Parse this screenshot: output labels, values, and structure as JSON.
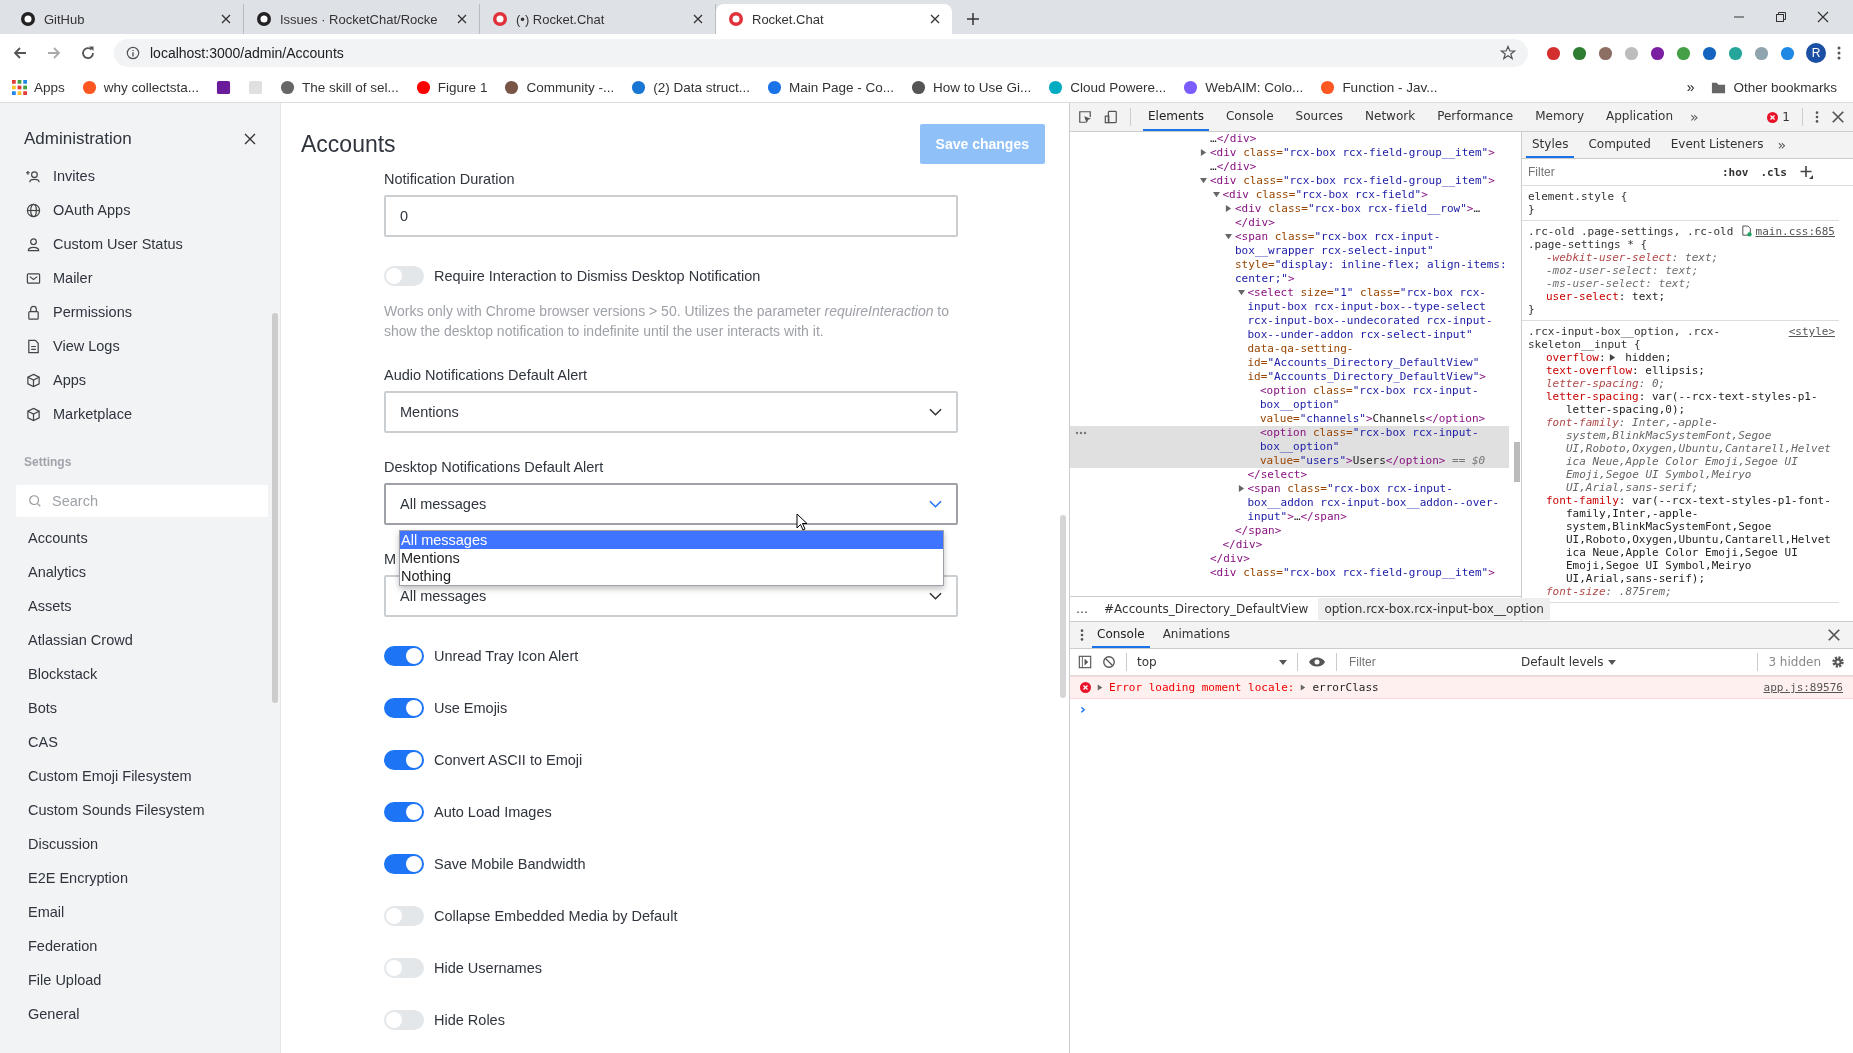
{
  "browser": {
    "tabs": [
      {
        "title": "GitHub",
        "selected": false
      },
      {
        "title": "Issues · RocketChat/Rocke",
        "selected": false
      },
      {
        "title": "(•) Rocket.Chat",
        "selected": false
      },
      {
        "title": "Rocket.Chat",
        "selected": true
      }
    ],
    "url": "localhost:3000/admin/Accounts",
    "profile_initial": "R",
    "bookmarks": [
      {
        "kind": "apps",
        "label": "Apps"
      },
      {
        "kind": "link",
        "label": "why collectsta..."
      },
      {
        "kind": "icon"
      },
      {
        "kind": "icon"
      },
      {
        "kind": "link",
        "label": "The skill of sel..."
      },
      {
        "kind": "link",
        "label": "Figure 1"
      },
      {
        "kind": "link",
        "label": "Community -..."
      },
      {
        "kind": "link",
        "label": "(2) Data struct..."
      },
      {
        "kind": "link",
        "label": "Main Page - Co..."
      },
      {
        "kind": "link",
        "label": "How to Use Gi..."
      },
      {
        "kind": "link",
        "label": "Cloud Powere..."
      },
      {
        "kind": "link",
        "label": "WebAIM: Colo..."
      },
      {
        "kind": "link",
        "label": "Function - Jav..."
      }
    ],
    "bookmarks_more": "»",
    "other_bookmarks": "Other bookmarks"
  },
  "sidebar": {
    "title": "Administration",
    "items": [
      "Invites",
      "OAuth Apps",
      "Custom User Status",
      "Mailer",
      "Permissions",
      "View Logs",
      "Apps",
      "Marketplace"
    ],
    "settings_heading": "Settings",
    "search": {
      "placeholder": "Search"
    },
    "settings": [
      "Accounts",
      "Analytics",
      "Assets",
      "Atlassian Crowd",
      "Blockstack",
      "Bots",
      "CAS",
      "Custom Emoji Filesystem",
      "Custom Sounds Filesystem",
      "Discussion",
      "E2E Encryption",
      "Email",
      "Federation",
      "File Upload",
      "General"
    ]
  },
  "page": {
    "title": "Accounts",
    "save_button": {
      "label": "Save changes",
      "disabled": true
    },
    "fields": [
      {
        "kind": "input",
        "label": "Notification Duration",
        "value": "0"
      },
      {
        "kind": "toggle",
        "label": "Require Interaction to Dismiss Desktop Notification",
        "on": false,
        "help": "Works only with Chrome browser versions > 50. Utilizes the parameter *requireInteraction* to show the desktop notification to indefinite until the user interacts with it."
      },
      {
        "kind": "select",
        "label": "Audio Notifications Default Alert",
        "value": "Mentions",
        "expanded": false
      },
      {
        "kind": "select",
        "label": "Desktop Notifications Default Alert",
        "value": "All messages",
        "expanded": true,
        "options": [
          {
            "label": "All messages",
            "selected": true
          },
          {
            "label": "Mentions",
            "selected": false
          },
          {
            "label": "Nothing",
            "selected": false
          }
        ]
      },
      {
        "kind": "select",
        "label": "M",
        "value": "All messages",
        "expanded": false
      },
      {
        "kind": "toggle",
        "label": "Unread Tray Icon Alert",
        "on": true
      },
      {
        "kind": "toggle",
        "label": "Use Emojis",
        "on": true
      },
      {
        "kind": "toggle",
        "label": "Convert ASCII to Emoji",
        "on": true
      },
      {
        "kind": "toggle",
        "label": "Auto Load Images",
        "on": true
      },
      {
        "kind": "toggle",
        "label": "Save Mobile Bandwidth",
        "on": true
      },
      {
        "kind": "toggle",
        "label": "Collapse Embedded Media by Default",
        "on": false
      },
      {
        "kind": "toggle",
        "label": "Hide Usernames",
        "on": false
      },
      {
        "kind": "toggle",
        "label": "Hide Roles",
        "on": false
      }
    ]
  },
  "devtools": {
    "tabs": [
      {
        "label": "Elements",
        "selected": true
      },
      {
        "label": "Console",
        "selected": false
      },
      {
        "label": "Sources",
        "selected": false
      },
      {
        "label": "Network",
        "selected": false
      },
      {
        "label": "Performance",
        "selected": false
      },
      {
        "label": "Memory",
        "selected": false
      },
      {
        "label": "Application",
        "selected": false
      }
    ],
    "tabs_more": "»",
    "error_count": "1",
    "elements": {
      "nodes": [
        {
          "text": "…</div>",
          "selected": false
        },
        {
          "expanded": false,
          "text": "<div class=\"rcx-box rcx-field-group__item\">",
          "close": "…</div>",
          "selected": false
        },
        {
          "expanded": true,
          "text": "<div class=\"rcx-box rcx-field-group__item\">",
          "selected": false,
          "close": "</div>",
          "children": [
            {
              "expanded": true,
              "text": "<div class=\"rcx-box rcx-field\">",
              "selected": false,
              "close": "</div>",
              "children": [
                {
                  "expanded": false,
                  "text": "<div class=\"rcx-box rcx-field__row\">…",
                  "close": "</div>",
                  "selected": false
                },
                {
                  "expanded": true,
                  "text": "<span class=\"rcx-box rcx-input-box__wrapper rcx-select-input\" style=\"display: inline-flex; align-items: center;\">",
                  "selected": false,
                  "close": "</span>",
                  "children": [
                    {
                      "expanded": true,
                      "text": "<select size=\"1\" class=\"rcx-box rcx-input-box rcx-input-box--type-select rcx-input-box--undecorated rcx-input-box--under-addon rcx-select-input\" data-qa-setting-id=\"Accounts_Directory_DefaultView\" id=\"Accounts_Directory_DefaultView\">",
                      "selected": false,
                      "close": "</select>",
                      "children": [
                        {
                          "text": "<option class=\"rcx-box rcx-input-box__option\" value=\"channels\">Channels</option>",
                          "selected": false
                        },
                        {
                          "text": "<option class=\"rcx-box rcx-input-box__option\" value=\"users\">Users</option>",
                          "suffix": "== $0",
                          "selected": true
                        }
                      ]
                    },
                    {
                      "expanded": false,
                      "text": "<span class=\"rcx-box rcx-input-box__addon rcx-input-box__addon--over-input\">…</span>",
                      "selected": false
                    }
                  ]
                }
              ]
            }
          ]
        },
        {
          "text": "<div class=\"rcx-box rcx-field-group__item\">",
          "selected": false
        }
      ]
    },
    "breadcrumbs": [
      {
        "label": "…",
        "selected": false
      },
      {
        "label": "#Accounts_Directory_DefaultView",
        "selected": false
      },
      {
        "label": "option.rcx-box.rcx-input-box__option",
        "selected": true
      }
    ],
    "styles": {
      "tabs": [
        {
          "label": "Styles",
          "selected": true
        },
        {
          "label": "Computed",
          "selected": false
        },
        {
          "label": "Event Listeners",
          "selected": false
        }
      ],
      "tabs_more": "»",
      "filter": {
        "placeholder": "Filter"
      },
      "hov": ":hov",
      "cls": ".cls",
      "rules": [
        {
          "selector": "element.style {",
          "close": "}"
        },
        {
          "selector": ".rc-old .page-settings, .rc-old .page-settings * {",
          "source": "main.css:685",
          "close": "}",
          "declarations": [
            {
              "text": "-webkit-user-select: text;",
              "overridden": true,
              "inactive": false,
              "expandable": false
            },
            {
              "text": "-moz-user-select: text;",
              "overridden": true,
              "inactive": true,
              "expandable": false
            },
            {
              "text": "-ms-user-select: text;",
              "overridden": true,
              "inactive": true,
              "expandable": false
            },
            {
              "text": "user-select: text;",
              "overridden": false,
              "inactive": false,
              "expandable": false
            }
          ]
        },
        {
          "selector": ".rcx-input-box__option, .rcx-skeleton__input {",
          "source": "<style>",
          "declarations": [
            {
              "text": "overflow: hidden;",
              "overridden": false,
              "inactive": false,
              "expandable": true
            },
            {
              "text": "text-overflow: ellipsis;",
              "overridden": false,
              "inactive": false,
              "expandable": false
            },
            {
              "text": "letter-spacing: 0;",
              "overridden": true,
              "inactive": false,
              "expandable": false
            },
            {
              "text": "letter-spacing: var(--rcx-text-styles-p1-letter-spacing,0);",
              "overridden": false,
              "inactive": false,
              "expandable": false
            },
            {
              "text": "font-family: Inter,-apple-system,BlinkMacSystemFont,Segoe UI,Roboto,Oxygen,Ubuntu,Cantarell,Helvetica Neue,Apple Color Emoji,Segoe UI Emoji,Segoe UI Symbol,Meiryo UI,Arial,sans-serif;",
              "overridden": true,
              "inactive": false,
              "expandable": false
            },
            {
              "text": "font-family: var(--rcx-text-styles-p1-font-family,Inter,-apple-system,BlinkMacSystemFont,Segoe UI,Roboto,Oxygen,Ubuntu,Cantarell,Helvetica Neue,Apple Color Emoji,Segoe UI Emoji,Segoe UI Symbol,Meiryo UI,Arial,sans-serif);",
              "overridden": false,
              "inactive": false,
              "expandable": false
            },
            {
              "text": "font-size: .875rem;",
              "overridden": true,
              "inactive": false,
              "expandable": false
            }
          ]
        }
      ]
    },
    "drawer": {
      "tabs": [
        {
          "label": "Console",
          "selected": true
        },
        {
          "label": "Animations",
          "selected": false
        }
      ],
      "context": "top",
      "filter": {
        "placeholder": "Filter"
      },
      "levels": "Default levels",
      "hidden": "3 hidden",
      "messages": [
        {
          "error": true,
          "text": "Error loading moment locale:",
          "object": "errorClass",
          "source": "app.js:89576"
        }
      ],
      "prompt": "›"
    }
  }
}
